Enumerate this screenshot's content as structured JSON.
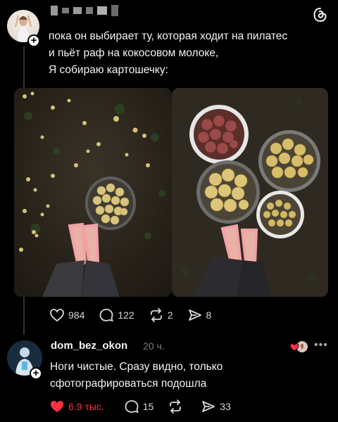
{
  "post": {
    "author_blurred": true,
    "text_lines": [
      "пока он выбирает ту, которая ходит на пилатес",
      "и пьёт раф на кокосовом молоке,",
      "Я собираю картошечку:"
    ],
    "stats": {
      "likes": "984",
      "comments": "122",
      "reposts": "2",
      "shares": "8"
    }
  },
  "reply": {
    "username": "dom_bez_okon",
    "time": "20 ч.",
    "text_lines": [
      "Ноги чистые. Сразу видно, только",
      "сфотографироваться подошла"
    ],
    "stats": {
      "likes": "6.9 тыс.",
      "comments": "15",
      "reposts": "",
      "shares": "33"
    }
  },
  "icons": {
    "like": "heart-icon",
    "comment": "comment-icon",
    "repost": "repost-icon",
    "share": "share-icon",
    "app": "threads-icon"
  },
  "colors": {
    "background": "#000000",
    "liked": "#ff3040",
    "muted": "#7d7d7d"
  }
}
